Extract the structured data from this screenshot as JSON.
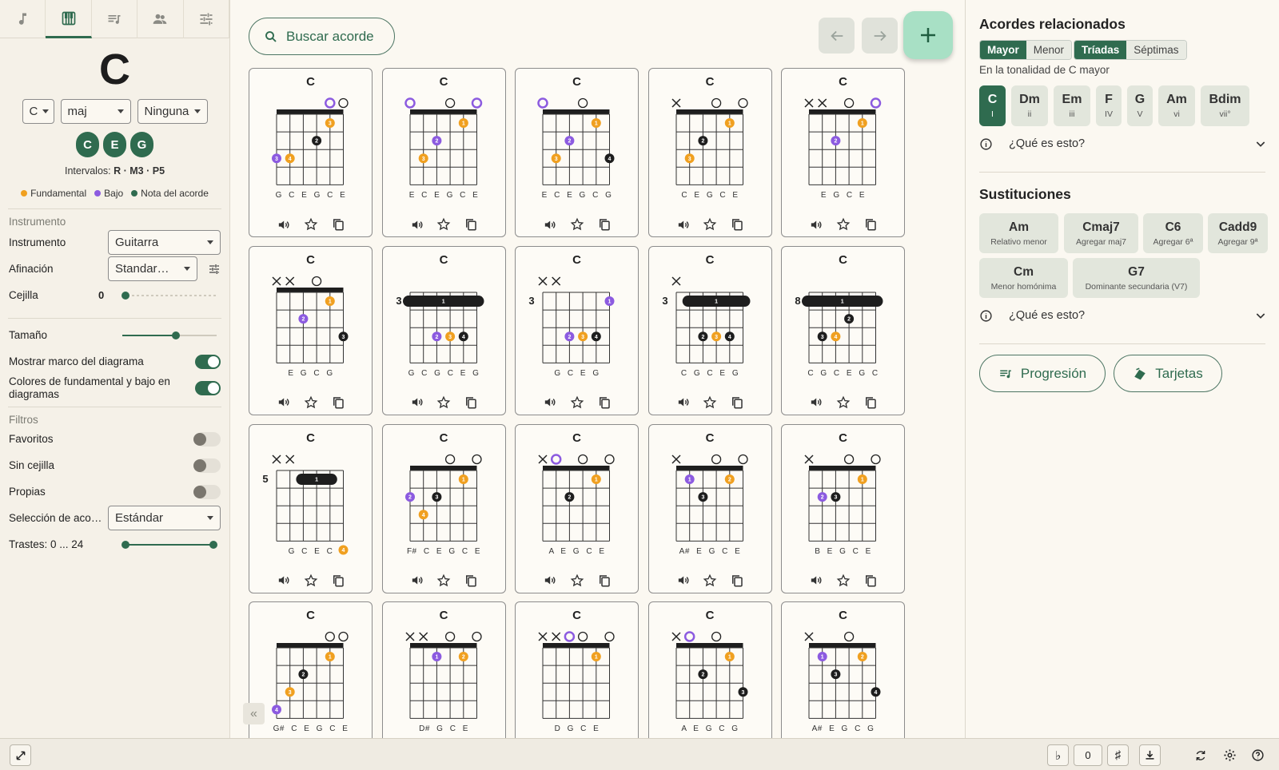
{
  "nav_tabs": [
    "music-note-icon",
    "piano-icon",
    "playlist-icon",
    "people-icon",
    "sliders-icon"
  ],
  "chord": {
    "name": "C",
    "root": "C",
    "quality": "maj",
    "inversion": "Ninguna",
    "notes": [
      "C",
      "E",
      "G"
    ],
    "intervals_label": "Intervalos:",
    "intervals": "R · M3 · P5"
  },
  "legend": {
    "root": "Fundamental",
    "bass": "Bajo",
    "note": "Nota del acorde"
  },
  "instrument_section": {
    "title": "Instrumento",
    "instrument_label": "Instrumento",
    "instrument_value": "Guitarra",
    "tuning_label": "Afinación",
    "tuning_value": "Standar…",
    "capo_label": "Cejilla",
    "capo_value": "0",
    "size_label": "Tamaño",
    "size_fraction": 0.57,
    "show_frame_label": "Mostrar marco del diagrama",
    "colors_label": "Colores de fundamental y bajo en diagramas"
  },
  "filters": {
    "title": "Filtros",
    "favorites_label": "Favoritos",
    "no_barre_label": "Sin cejilla",
    "own_label": "Propias",
    "selection_label": "Selección de aco…",
    "selection_value": "Estándar",
    "frets_label": "Trastes: 0 ... 24"
  },
  "search": {
    "label": "Buscar acorde"
  },
  "colors": {
    "accent": "#2f6b4f",
    "root": "#f0a020",
    "bass": "#8c5be0",
    "note": "#1e1e1e"
  },
  "chart_data": {
    "type": "table",
    "cards": [
      {
        "title": "C",
        "fret": "",
        "strings": "G C E G C E",
        "mute": [],
        "open": [
          4,
          5
        ],
        "openbass": [
          4
        ],
        "dots": [
          [
            0,
            4,
            "R",
            3
          ],
          [
            1,
            3,
            "N",
            2
          ],
          [
            2,
            0,
            "B",
            3
          ],
          [
            2,
            1,
            "R",
            4
          ]
        ]
      },
      {
        "title": "C",
        "fret": "",
        "strings": "E C E G C E",
        "mute": [],
        "open": [
          0,
          3,
          5
        ],
        "openbass": [
          0,
          5
        ],
        "dots": [
          [
            0,
            4,
            "R",
            1
          ],
          [
            1,
            2,
            "B",
            2
          ],
          [
            2,
            1,
            "R",
            3
          ]
        ]
      },
      {
        "title": "C",
        "fret": "",
        "strings": "E C E G C G",
        "mute": [],
        "open": [
          0,
          3
        ],
        "openbass": [
          0
        ],
        "dots": [
          [
            0,
            4,
            "R",
            1
          ],
          [
            1,
            2,
            "B",
            2
          ],
          [
            2,
            1,
            "R",
            3
          ],
          [
            2,
            5,
            "N",
            4
          ]
        ]
      },
      {
        "title": "C",
        "fret": "",
        "strings": "C E G C E",
        "mute": [
          0
        ],
        "open": [
          3,
          5
        ],
        "openbass": [],
        "dots": [
          [
            0,
            4,
            "R",
            1
          ],
          [
            1,
            2,
            "N",
            2
          ],
          [
            2,
            1,
            "R",
            3
          ]
        ]
      },
      {
        "title": "C",
        "fret": "",
        "strings": "E G C E",
        "mute": [
          0,
          1
        ],
        "open": [
          3,
          5
        ],
        "openbass": [
          5
        ],
        "dots": [
          [
            0,
            4,
            "R",
            1
          ],
          [
            1,
            2,
            "B",
            2
          ]
        ]
      },
      {
        "title": "C",
        "fret": "",
        "strings": "E G C G",
        "mute": [
          0,
          1
        ],
        "open": [
          3
        ],
        "openbass": [],
        "dots": [
          [
            0,
            4,
            "R",
            1
          ],
          [
            1,
            2,
            "B",
            2
          ],
          [
            2,
            5,
            "N",
            3
          ]
        ]
      },
      {
        "title": "C",
        "fret": "3",
        "strings": "G C G C E G",
        "mute": [],
        "open": [],
        "openbass": [],
        "barre": [
          0,
          5,
          "1"
        ],
        "dots": [
          [
            2,
            2,
            "B",
            2
          ],
          [
            2,
            3,
            "R",
            3
          ],
          [
            2,
            4,
            "N",
            4
          ]
        ]
      },
      {
        "title": "C",
        "fret": "3",
        "strings": "G C E G",
        "mute": [
          0,
          1
        ],
        "open": [],
        "openbass": [],
        "dots": [
          [
            0,
            5,
            "B",
            1
          ],
          [
            2,
            2,
            "B",
            2
          ],
          [
            2,
            3,
            "R",
            3
          ],
          [
            2,
            4,
            "N",
            4
          ]
        ]
      },
      {
        "title": "C",
        "fret": "3",
        "strings": "C G C E G",
        "mute": [
          0
        ],
        "open": [],
        "openbass": [],
        "barre": [
          1,
          5,
          "1"
        ],
        "dots": [
          [
            2,
            2,
            "N",
            2
          ],
          [
            2,
            3,
            "R",
            3
          ],
          [
            2,
            4,
            "N",
            4
          ]
        ]
      },
      {
        "title": "C",
        "fret": "8",
        "strings": "C G C E G C",
        "mute": [],
        "open": [],
        "openbass": [],
        "barre": [
          0,
          5,
          "1"
        ],
        "dots": [
          [
            1,
            3,
            "N",
            2
          ],
          [
            2,
            1,
            "N",
            3
          ],
          [
            2,
            2,
            "R",
            4
          ]
        ]
      },
      {
        "title": "C",
        "fret": "5",
        "strings": "G C E C",
        "mute": [
          0,
          1
        ],
        "open": [],
        "openbass": [],
        "barre": [
          2,
          4,
          "1"
        ],
        "dots": [
          [
            4,
            5,
            "R",
            4
          ]
        ]
      },
      {
        "title": "C",
        "fret": "",
        "strings": "F# C E G C E",
        "mute": [],
        "open": [
          3,
          5
        ],
        "openbass": [],
        "dots": [
          [
            0,
            4,
            "R",
            1
          ],
          [
            1,
            0,
            "B",
            2
          ],
          [
            1,
            2,
            "N",
            3
          ],
          [
            2,
            1,
            "R",
            4
          ]
        ]
      },
      {
        "title": "C",
        "fret": "",
        "strings": "A E G C E",
        "mute": [
          0
        ],
        "open": [
          1,
          3,
          5
        ],
        "openbass": [
          1
        ],
        "dots": [
          [
            0,
            4,
            "R",
            1
          ],
          [
            1,
            2,
            "N",
            2
          ]
        ]
      },
      {
        "title": "C",
        "fret": "",
        "strings": "A# E G C E",
        "mute": [
          0
        ],
        "open": [
          3,
          5
        ],
        "openbass": [],
        "dots": [
          [
            0,
            1,
            "B",
            1
          ],
          [
            0,
            4,
            "R",
            2
          ],
          [
            1,
            2,
            "N",
            3
          ]
        ]
      },
      {
        "title": "C",
        "fret": "",
        "strings": "B E G C E",
        "mute": [
          0
        ],
        "open": [
          3,
          5
        ],
        "openbass": [],
        "dots": [
          [
            0,
            4,
            "R",
            1
          ],
          [
            1,
            1,
            "B",
            2
          ],
          [
            1,
            2,
            "N",
            3
          ]
        ]
      },
      {
        "title": "C",
        "fret": "",
        "strings": "G# C E G C E",
        "mute": [],
        "open": [
          4,
          5
        ],
        "openbass": [],
        "dots": [
          [
            0,
            4,
            "R",
            1
          ],
          [
            1,
            2,
            "N",
            2
          ],
          [
            2,
            1,
            "R",
            3
          ],
          [
            3,
            0,
            "B",
            4
          ]
        ]
      },
      {
        "title": "C",
        "fret": "",
        "strings": "D# G C E",
        "mute": [
          0,
          1
        ],
        "open": [
          3,
          5
        ],
        "openbass": [],
        "dots": [
          [
            0,
            2,
            "B",
            1
          ],
          [
            0,
            4,
            "R",
            2
          ]
        ]
      },
      {
        "title": "C",
        "fret": "",
        "strings": "D G C E",
        "mute": [
          0,
          1
        ],
        "open": [
          2,
          3,
          5
        ],
        "openbass": [
          2
        ],
        "dots": [
          [
            0,
            4,
            "R",
            1
          ]
        ]
      },
      {
        "title": "C",
        "fret": "",
        "strings": "A E G C G",
        "mute": [
          0
        ],
        "open": [
          1,
          3
        ],
        "openbass": [
          1
        ],
        "dots": [
          [
            0,
            4,
            "R",
            1
          ],
          [
            1,
            2,
            "N",
            2
          ],
          [
            2,
            5,
            "N",
            3
          ]
        ]
      },
      {
        "title": "C",
        "fret": "",
        "strings": "A# E G C G",
        "mute": [
          0
        ],
        "open": [
          3
        ],
        "openbass": [],
        "dots": [
          [
            0,
            1,
            "B",
            1
          ],
          [
            0,
            4,
            "R",
            2
          ],
          [
            1,
            2,
            "N",
            3
          ],
          [
            2,
            5,
            "N",
            4
          ]
        ]
      }
    ]
  },
  "related": {
    "title": "Acordes relacionados",
    "seg1": [
      "Mayor",
      "Menor"
    ],
    "seg2": [
      "Tríadas",
      "Séptimas"
    ],
    "key_text": "En la tonalidad de C mayor",
    "degrees": [
      {
        "n": "C",
        "r": "I"
      },
      {
        "n": "Dm",
        "r": "ii"
      },
      {
        "n": "Em",
        "r": "iii"
      },
      {
        "n": "F",
        "r": "IV"
      },
      {
        "n": "G",
        "r": "V"
      },
      {
        "n": "Am",
        "r": "vi"
      },
      {
        "n": "Bdim",
        "r": "vii°"
      }
    ],
    "what": "¿Qué es esto?"
  },
  "subs": {
    "title": "Sustituciones",
    "items": [
      {
        "n": "Am",
        "d": "Relativo menor"
      },
      {
        "n": "Cmaj7",
        "d": "Agregar maj7"
      },
      {
        "n": "C6",
        "d": "Agregar 6ª"
      },
      {
        "n": "Cadd9",
        "d": "Agregar 9ª"
      },
      {
        "n": "Cm",
        "d": "Menor homónima"
      },
      {
        "n": "G7",
        "d": "Dominante secundaria (V7)"
      }
    ],
    "what": "¿Qué es esto?"
  },
  "actions": {
    "progression": "Progresión",
    "cards": "Tarjetas"
  },
  "bottom": {
    "flat": "♭",
    "transpose": "0",
    "sharp": "♯"
  }
}
